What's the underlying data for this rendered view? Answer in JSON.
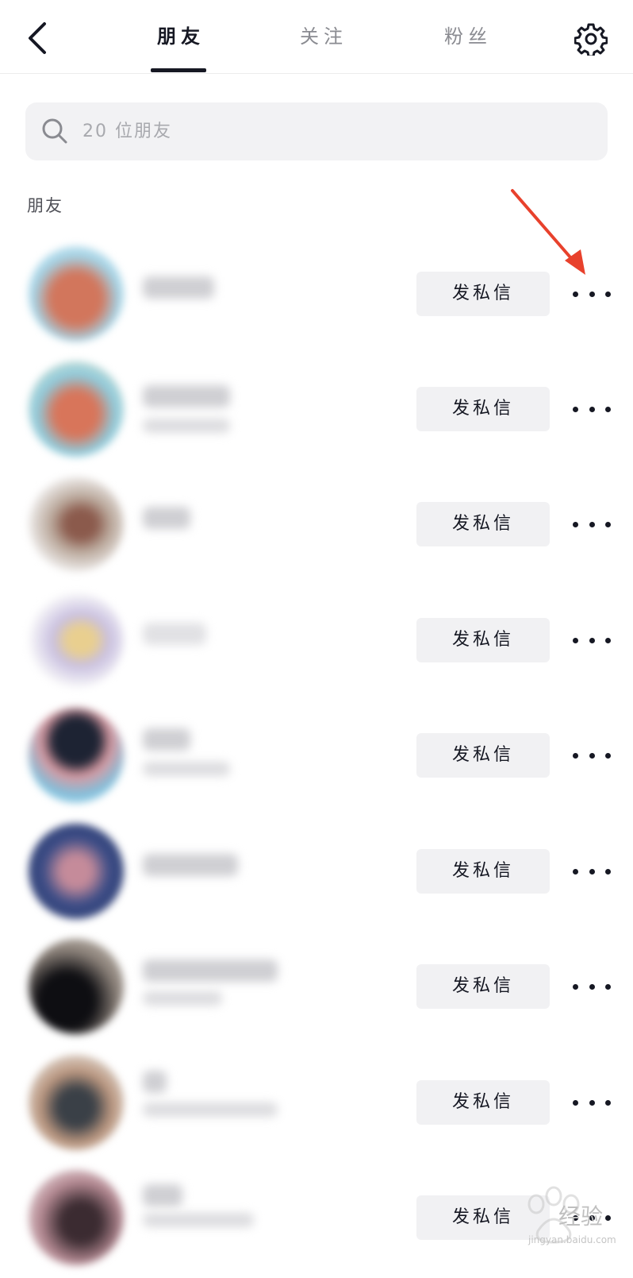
{
  "header": {
    "tabs": [
      {
        "label": "朋友",
        "active": true
      },
      {
        "label": "关注",
        "active": false
      },
      {
        "label": "粉丝",
        "active": false
      }
    ]
  },
  "search": {
    "placeholder": "20 位朋友"
  },
  "section_title": "朋友",
  "friends": [
    {
      "button_label": "发私信",
      "avatar_color": "#e8b7a6"
    },
    {
      "button_label": "发私信",
      "avatar_color": "#9ec9d8"
    },
    {
      "button_label": "发私信",
      "avatar_color": "#b89a8a"
    },
    {
      "button_label": "发私信",
      "avatar_color": "#e8d9b8"
    },
    {
      "button_label": "发私信",
      "avatar_color": "#6a7ea8"
    },
    {
      "button_label": "发私信",
      "avatar_color": "#3e4f86"
    },
    {
      "button_label": "发私信",
      "avatar_color": "#3a3a3f"
    },
    {
      "button_label": "发私信",
      "avatar_color": "#8b8478"
    },
    {
      "button_label": "发私信",
      "avatar_color": "#8b6f74"
    }
  ],
  "watermark": {
    "text": "经验",
    "url": "jingyan.baidu.com"
  },
  "colors": {
    "arrow": "#e8412c",
    "text_primary": "#161823",
    "text_muted": "#8a8b91"
  }
}
